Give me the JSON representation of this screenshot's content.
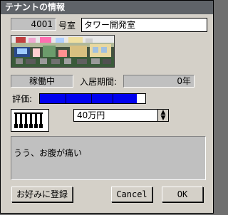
{
  "window": {
    "title": "テナントの情報"
  },
  "tenant": {
    "room_number": "4001",
    "room_suffix": "号室",
    "name": "タワー開発室",
    "status": "稼働中",
    "period_label": "入居期間:",
    "period_value": "0年",
    "rating_label": "評価:",
    "rating_fraction": 0.92,
    "rent_value": "40万円",
    "comment": "うう、お腹が痛い"
  },
  "buttons": {
    "favorite": "お好みに登録",
    "cancel": "Cancel",
    "ok": "OK"
  },
  "colors": {
    "rating_fill": "#0000ee",
    "window_bg": "#d4d0c8",
    "title_bg": "#5f6368"
  }
}
